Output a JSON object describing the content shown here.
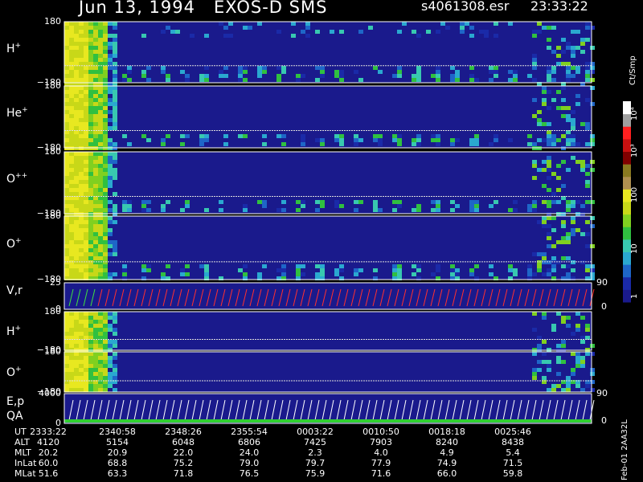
{
  "title": {
    "date": "Jun 13, 1994",
    "instrument": "EXOS-D SMS",
    "file": "s4061308.esr",
    "time": "23:33:22"
  },
  "colors": {
    "background": "#000000",
    "low": "#1a1a8c",
    "scale": [
      "#1a1a8c",
      "#1a2aa8",
      "#1e66c8",
      "#2aa8d0",
      "#38c8b0",
      "#30c040",
      "#80d020",
      "#c8d818",
      "#e8e820",
      "#b09050",
      "#8a7a20",
      "#800000",
      "#c81010",
      "#ff2020",
      "#a0a0a0",
      "#ffffff"
    ]
  },
  "chart_data": [
    {
      "type": "heatmap",
      "label_base": "H",
      "label_sup": "+",
      "yrange": [
        -180,
        180
      ],
      "ytick_top": "180",
      "ytick_bottom": "−180"
    },
    {
      "type": "heatmap",
      "label_base": "He",
      "label_sup": "+",
      "yrange": [
        -180,
        180
      ],
      "ytick_top": "180",
      "ytick_bottom": "−180"
    },
    {
      "type": "heatmap",
      "label_base": "O",
      "label_sup": "++",
      "yrange": [
        -180,
        180
      ],
      "ytick_top": "180",
      "ytick_bottom": "−180"
    },
    {
      "type": "heatmap",
      "label_base": "O",
      "label_sup": "+",
      "yrange": [
        -180,
        180
      ],
      "ytick_top": "180",
      "ytick_bottom": "−180"
    },
    {
      "type": "line",
      "label": "V,r",
      "yrange": [
        0,
        25
      ],
      "ytick_top": "25",
      "ytick_bottom": "0",
      "right_tick_top": "90",
      "right_tick_bottom": "0"
    },
    {
      "type": "heatmap",
      "label_base": "H",
      "label_sup": "+",
      "yrange": [
        -180,
        180
      ],
      "ytick_top": "180",
      "ytick_bottom": "−180"
    },
    {
      "type": "heatmap",
      "label_base": "O",
      "label_sup": "+",
      "yrange": [
        -180,
        180
      ],
      "ytick_top": "180",
      "ytick_bottom": "−180"
    },
    {
      "type": "line",
      "label": "E,p",
      "label2": "QA",
      "yrange": [
        0,
        4000
      ],
      "ytick_top": "4000",
      "ytick_bottom": "0",
      "right_tick_top": "90",
      "right_tick_bottom": "0"
    }
  ],
  "colorbar": {
    "unit": "Ct/Smp",
    "ticks": [
      "10⁴",
      "10³",
      "100",
      "10",
      "1"
    ]
  },
  "table": {
    "row_labels": [
      "UT",
      "ALT",
      "MLT",
      "InLat",
      "MLat"
    ],
    "columns": [
      [
        "2333:22",
        "4120",
        "20.2",
        "60.0",
        "51.6"
      ],
      [
        "2340:58",
        "5154",
        "20.9",
        "68.8",
        "63.3"
      ],
      [
        "2348:26",
        "6048",
        "22.0",
        "75.2",
        "71.8"
      ],
      [
        "2355:54",
        "6806",
        "24.0",
        "79.0",
        "76.5"
      ],
      [
        "0003:22",
        "7425",
        "2.3",
        "79.7",
        "75.9"
      ],
      [
        "0010:50",
        "7903",
        "4.0",
        "77.9",
        "71.6"
      ],
      [
        "0018:18",
        "8240",
        "4.9",
        "74.9",
        "66.0"
      ],
      [
        "0025:46",
        "8438",
        "5.4",
        "71.5",
        "59.8"
      ]
    ]
  },
  "footer": "Feb-01 2AA32L"
}
